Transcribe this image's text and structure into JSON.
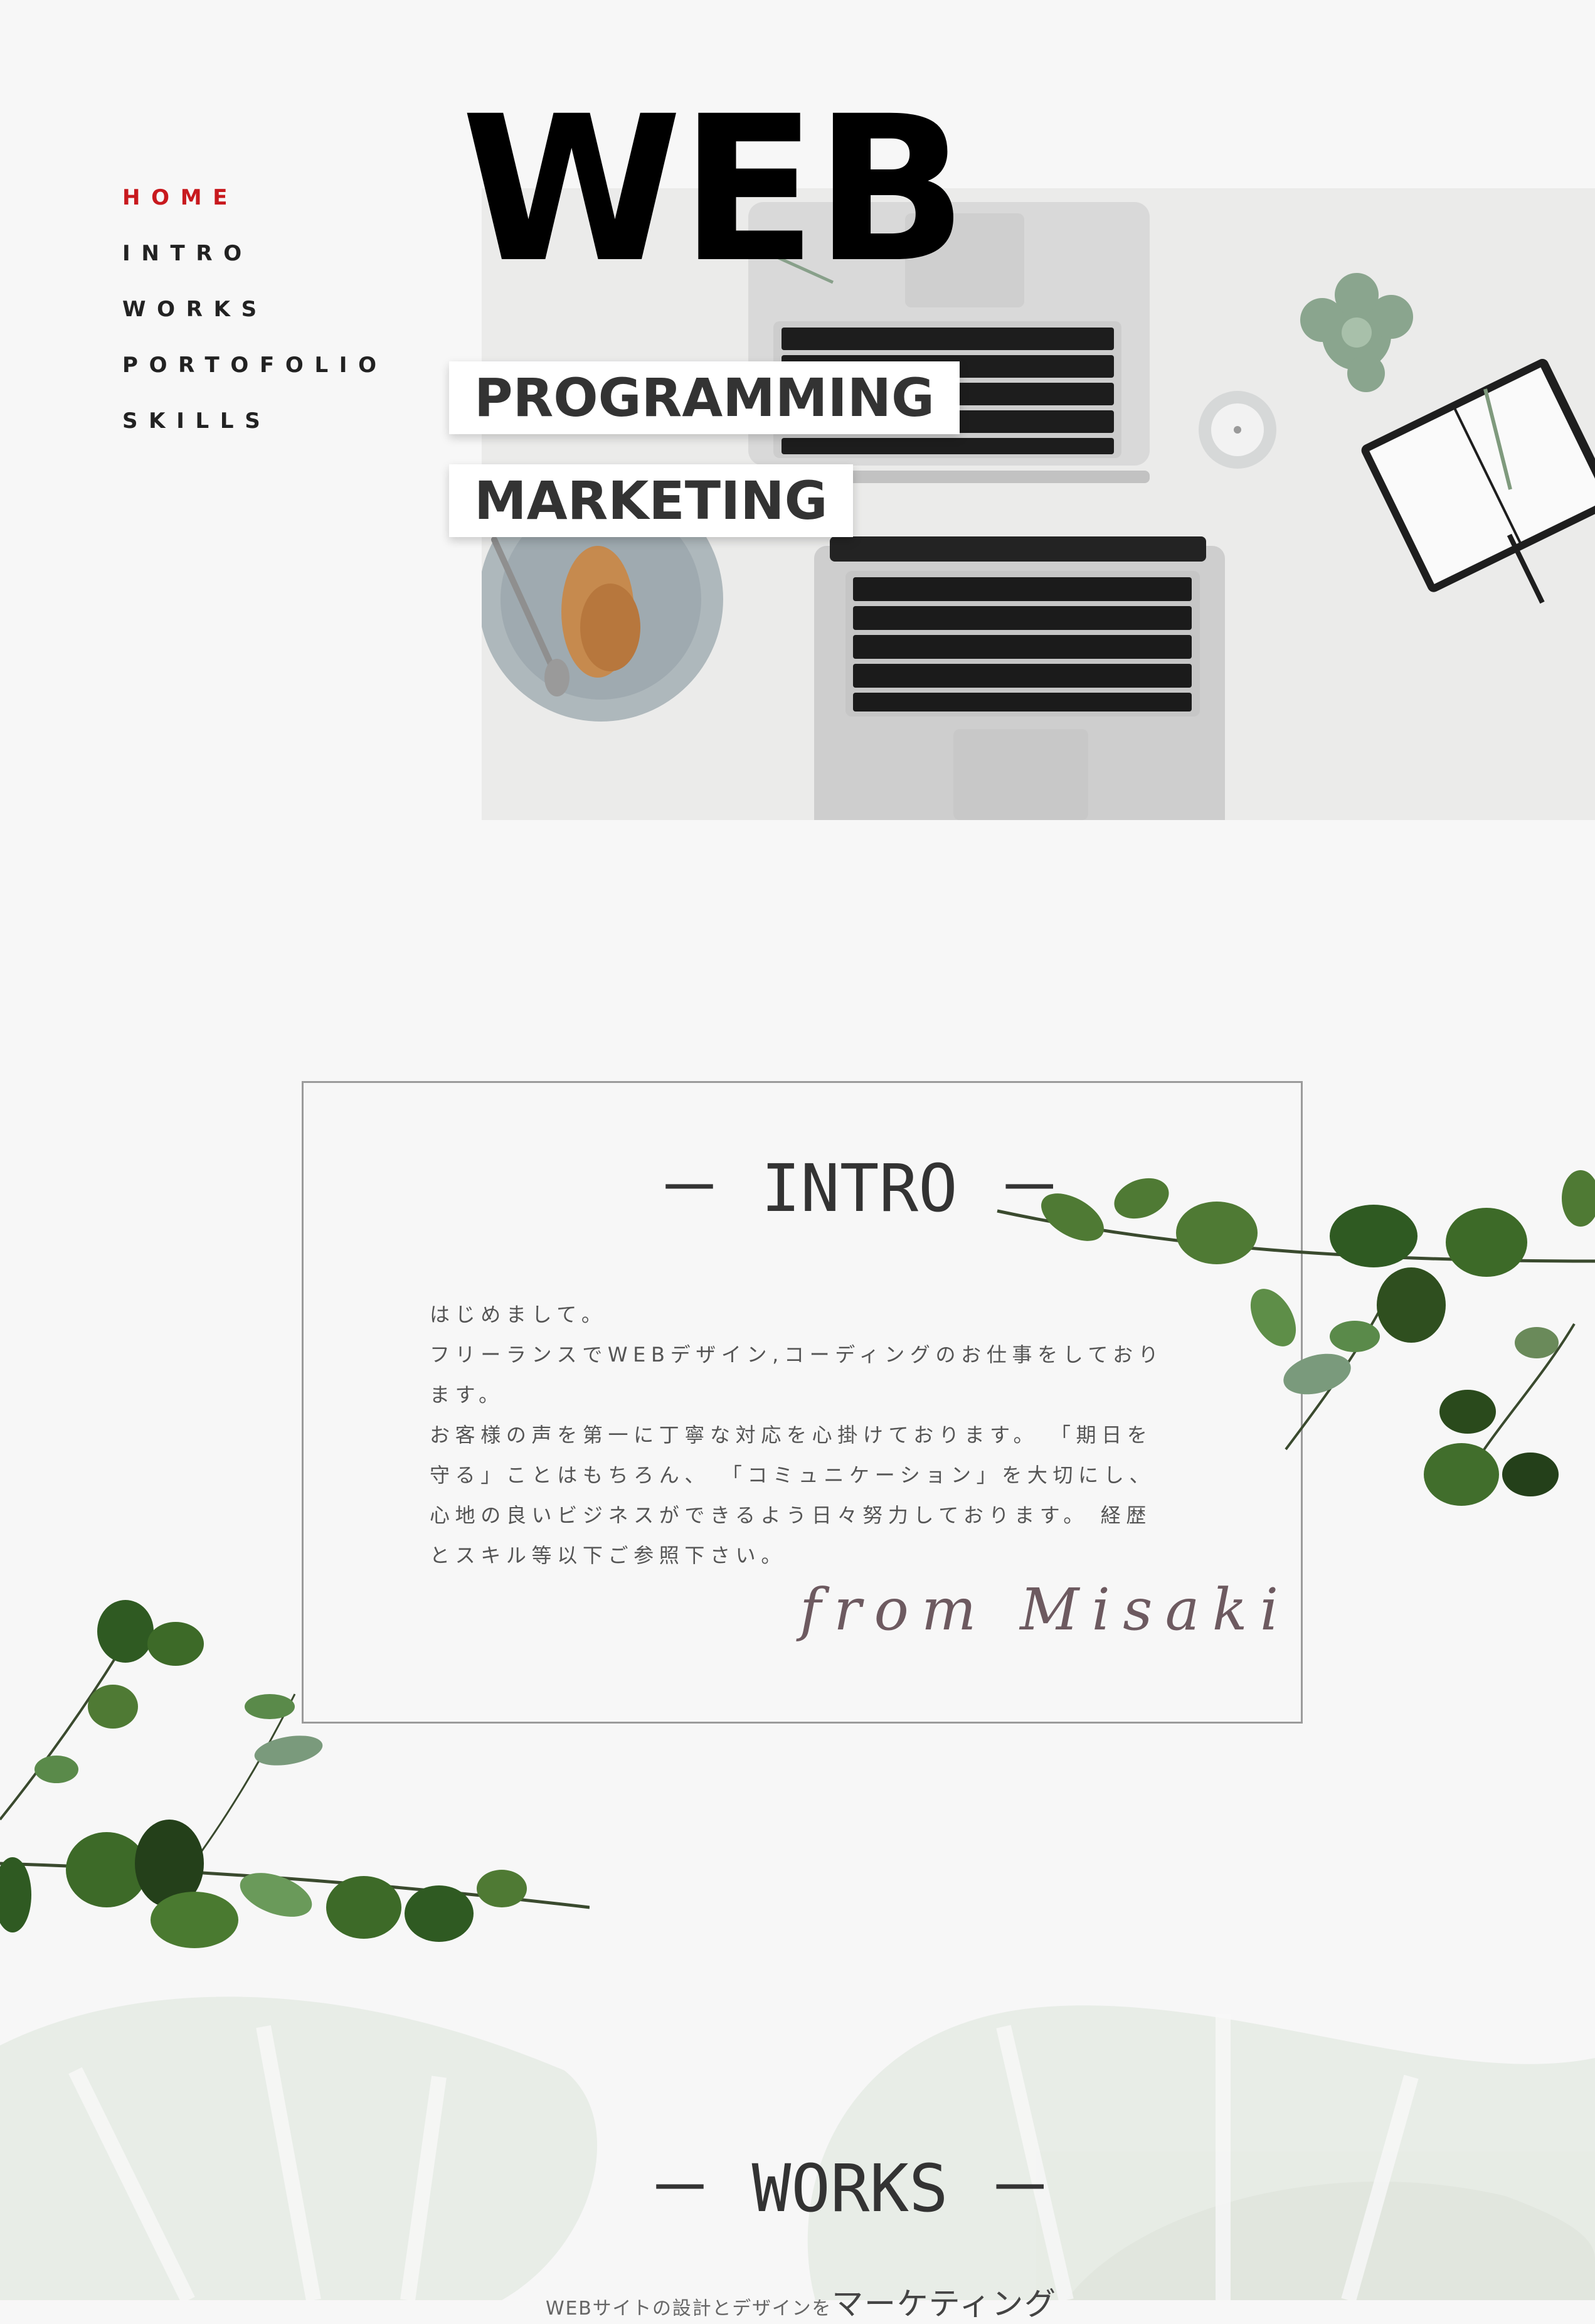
{
  "nav": {
    "items": [
      {
        "label": "HOME",
        "active": true
      },
      {
        "label": "INTRO",
        "active": false
      },
      {
        "label": "WORKS",
        "active": false
      },
      {
        "label": "PORTOFOLIO",
        "active": false
      },
      {
        "label": "SKILLS",
        "active": false
      }
    ],
    "active_color": "#c8191e"
  },
  "hero": {
    "title": "WEB",
    "tags": [
      "PROGRAMMING",
      "MARKETING"
    ]
  },
  "intro": {
    "title": "－ INTRO －",
    "paragraphs": [
      "はじめまして。",
      "フリーランスでWEBデザイン,コーディングのお仕事をしております。",
      "お客様の声を第一に丁寧な対応を心掛けております。 「期日を守る」ことはもちろん、 「コミュニケーション」を大切にし、心地の良いビジネスができるよう日々努力しております。 経歴とスキル等以下ご参照下さい。"
    ],
    "signature": "from Misaki"
  },
  "works": {
    "title": "－ WORKS －",
    "subtitle_small": "WEBサイトの設計とデザインを",
    "subtitle_large": "マーケティング"
  }
}
